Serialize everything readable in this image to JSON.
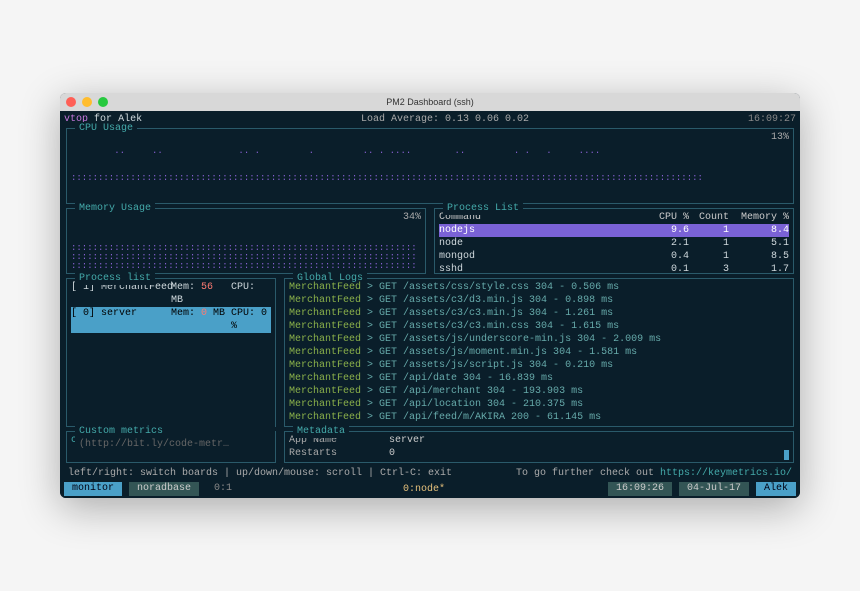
{
  "window": {
    "title": "PM2 Dashboard (ssh)"
  },
  "top": {
    "app": "vtop",
    "for": "for",
    "user": "Alek",
    "load_label": "Load Average:",
    "load": "0.13 0.06 0.02",
    "clock": "16:09:27"
  },
  "cpu": {
    "title": "CPU Usage",
    "pct": "13%"
  },
  "memory": {
    "title": "Memory Usage",
    "pct": "34%"
  },
  "process_top": {
    "title": "Process List",
    "headers": {
      "command": "Command",
      "cpu": "CPU %",
      "count": "Count",
      "mem": "Memory %"
    },
    "rows": [
      {
        "cmd": "nodejs",
        "cpu": "9.6",
        "count": "1",
        "mem": "8.4",
        "selected": true
      },
      {
        "cmd": "node",
        "cpu": "2.1",
        "count": "1",
        "mem": "5.1",
        "selected": false
      },
      {
        "cmd": "mongod",
        "cpu": "0.4",
        "count": "1",
        "mem": "8.5",
        "selected": false
      },
      {
        "cmd": "sshd",
        "cpu": "0.1",
        "count": "3",
        "mem": "1.7",
        "selected": false
      }
    ]
  },
  "process_left": {
    "title": "Process list",
    "rows": [
      {
        "idx": "[ 1]",
        "name": "MerchantFeed",
        "mem_lbl": "Mem:",
        "mem": "56",
        "mem_unit": "MB",
        "cpu_lbl": "CPU:",
        "cpu": "",
        "selected": false
      },
      {
        "idx": "[ 0]",
        "name": "server",
        "mem_lbl": "Mem:",
        "mem": "0",
        "mem_unit": "MB",
        "cpu_lbl": "CPU:",
        "cpu": "0 %",
        "selected": true
      }
    ]
  },
  "logs": {
    "title": "Global Logs",
    "rows": [
      {
        "src": "MerchantFeed",
        "txt": "> GET /assets/css/style.css 304 - 0.506 ms"
      },
      {
        "src": "MerchantFeed",
        "txt": "> GET /assets/c3/d3.min.js 304 - 0.898 ms"
      },
      {
        "src": "MerchantFeed",
        "txt": "> GET /assets/c3/c3.min.js 304 - 1.261 ms"
      },
      {
        "src": "MerchantFeed",
        "txt": "> GET /assets/c3/c3.min.css 304 - 1.615 ms"
      },
      {
        "src": "MerchantFeed",
        "txt": "> GET /assets/js/underscore-min.js 304 - 2.009 ms"
      },
      {
        "src": "MerchantFeed",
        "txt": "> GET /assets/js/moment.min.js 304 - 1.581 ms"
      },
      {
        "src": "MerchantFeed",
        "txt": "> GET /assets/js/script.js 304 - 0.210 ms"
      },
      {
        "src": "MerchantFeed",
        "txt": "> GET /api/date 304 - 16.839 ms"
      },
      {
        "src": "MerchantFeed",
        "txt": "> GET /api/merchant 304 - 193.903 ms"
      },
      {
        "src": "MerchantFeed",
        "txt": "> GET /api/location 304 - 210.375 ms"
      },
      {
        "src": "MerchantFeed",
        "txt": "> GET /api/feed/m/AKIRA 200 - 61.145 ms"
      }
    ]
  },
  "metrics": {
    "title": "Custom metrics",
    "link": "(http://bit.ly/code-metr…",
    "body": "cs)"
  },
  "metadata": {
    "title": "Metadata",
    "rows": [
      {
        "k": "App Name",
        "v": "server"
      },
      {
        "k": "Restarts",
        "v": "0"
      }
    ]
  },
  "hints": {
    "left": "left/right: switch boards | up/down/mouse: scroll | Ctrl-C: exit",
    "right_pre": "To go further check out ",
    "right_link": "https://keymetrics.io/"
  },
  "statusbar": {
    "left1": "monitor",
    "left2": "noradbase",
    "left3": "0:1",
    "center": "0:node*",
    "r1": "16:09:26",
    "r2": "04-Jul-17",
    "r3": "Alek"
  }
}
